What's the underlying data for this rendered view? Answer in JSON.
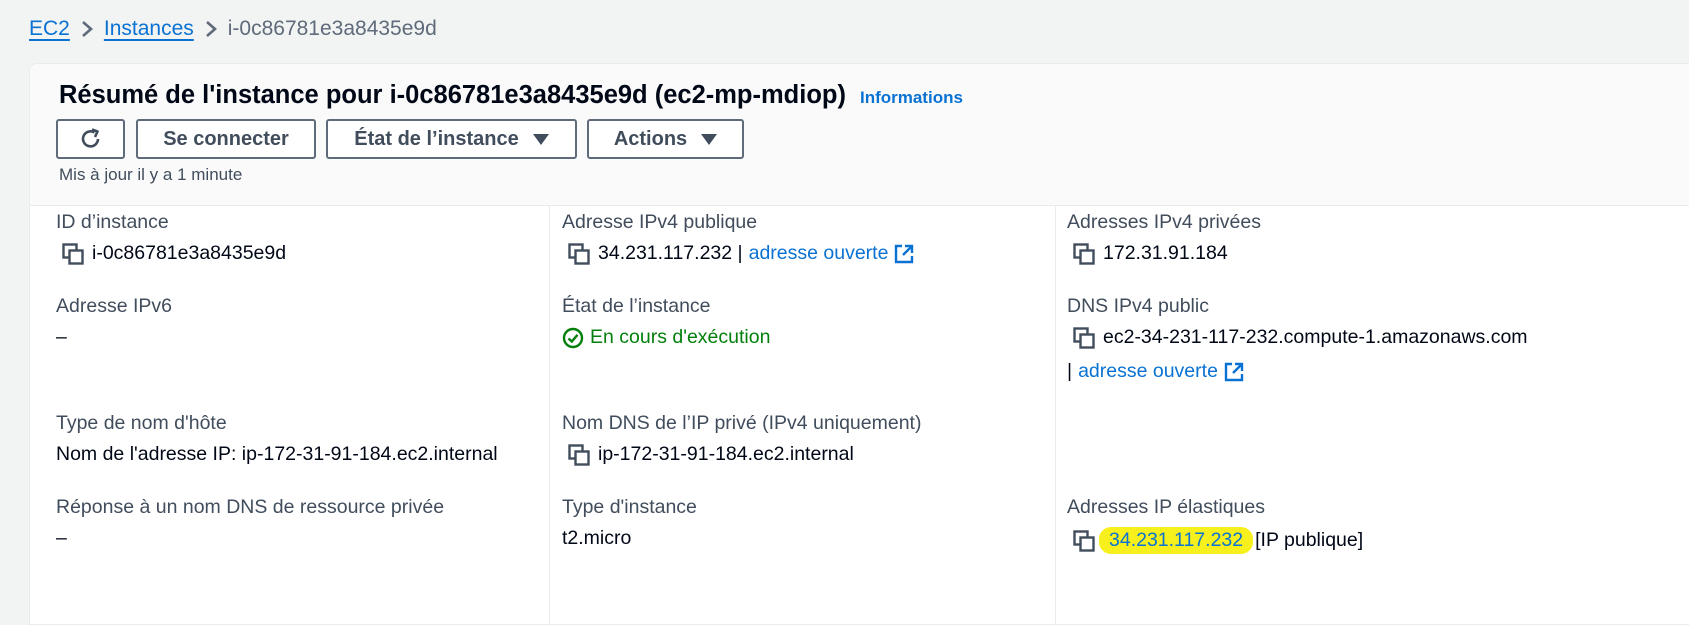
{
  "breadcrumb": {
    "ec2": "EC2",
    "instances": "Instances",
    "current": "i-0c86781e3a8435e9d"
  },
  "header": {
    "title": "Résumé de l'instance pour i-0c86781e3a8435e9d (ec2-mp-mdiop)",
    "info_link": "Informations",
    "connect_button": "Se connecter",
    "instance_state_button": "État de l’instance",
    "actions_button": "Actions",
    "updated": "Mis à jour il y a 1 minute"
  },
  "details": {
    "instance_id": {
      "label": "ID d’instance",
      "value": "i-0c86781e3a8435e9d"
    },
    "ipv6": {
      "label": "Adresse IPv6",
      "value": "–"
    },
    "hostname_type": {
      "label": "Type de nom d'hôte",
      "value": "Nom de l'adresse IP: ip-172-31-91-184.ec2.internal"
    },
    "private_dns_answer": {
      "label": "Réponse à un nom DNS de ressource privée",
      "value": "–"
    },
    "public_ipv4": {
      "label": "Adresse IPv4 publique",
      "value": "34.231.117.232 |",
      "link": "adresse ouverte"
    },
    "instance_state": {
      "label": "État de l’instance",
      "value": "En cours d'exécution"
    },
    "private_ip_dns": {
      "label": "Nom DNS de l’IP privé (IPv4 uniquement)",
      "value": "ip-172-31-91-184.ec2.internal"
    },
    "instance_type": {
      "label": "Type d'instance",
      "value": "t2.micro"
    },
    "private_ipv4": {
      "label": "Adresses IPv4 privées",
      "value": "172.31.91.184"
    },
    "public_dns": {
      "label": "DNS IPv4 public",
      "value": "ec2-34-231-117-232.compute-1.amazonaws.com",
      "separator": "|",
      "link": "adresse ouverte"
    },
    "elastic_ip": {
      "label": "Adresses IP élastiques",
      "value": "34.231.117.232",
      "suffix": "[IP publique]"
    }
  },
  "colors": {
    "link": "#0972d3",
    "success": "#037f0c",
    "highlight": "#f7f01d",
    "label": "#414d5c"
  },
  "icons": {
    "copy": "copy-icon",
    "external": "external-link-icon",
    "refresh": "refresh-icon",
    "status": "check-circle-icon",
    "chevron": "chevron-right-icon",
    "caret": "caret-down-icon"
  }
}
